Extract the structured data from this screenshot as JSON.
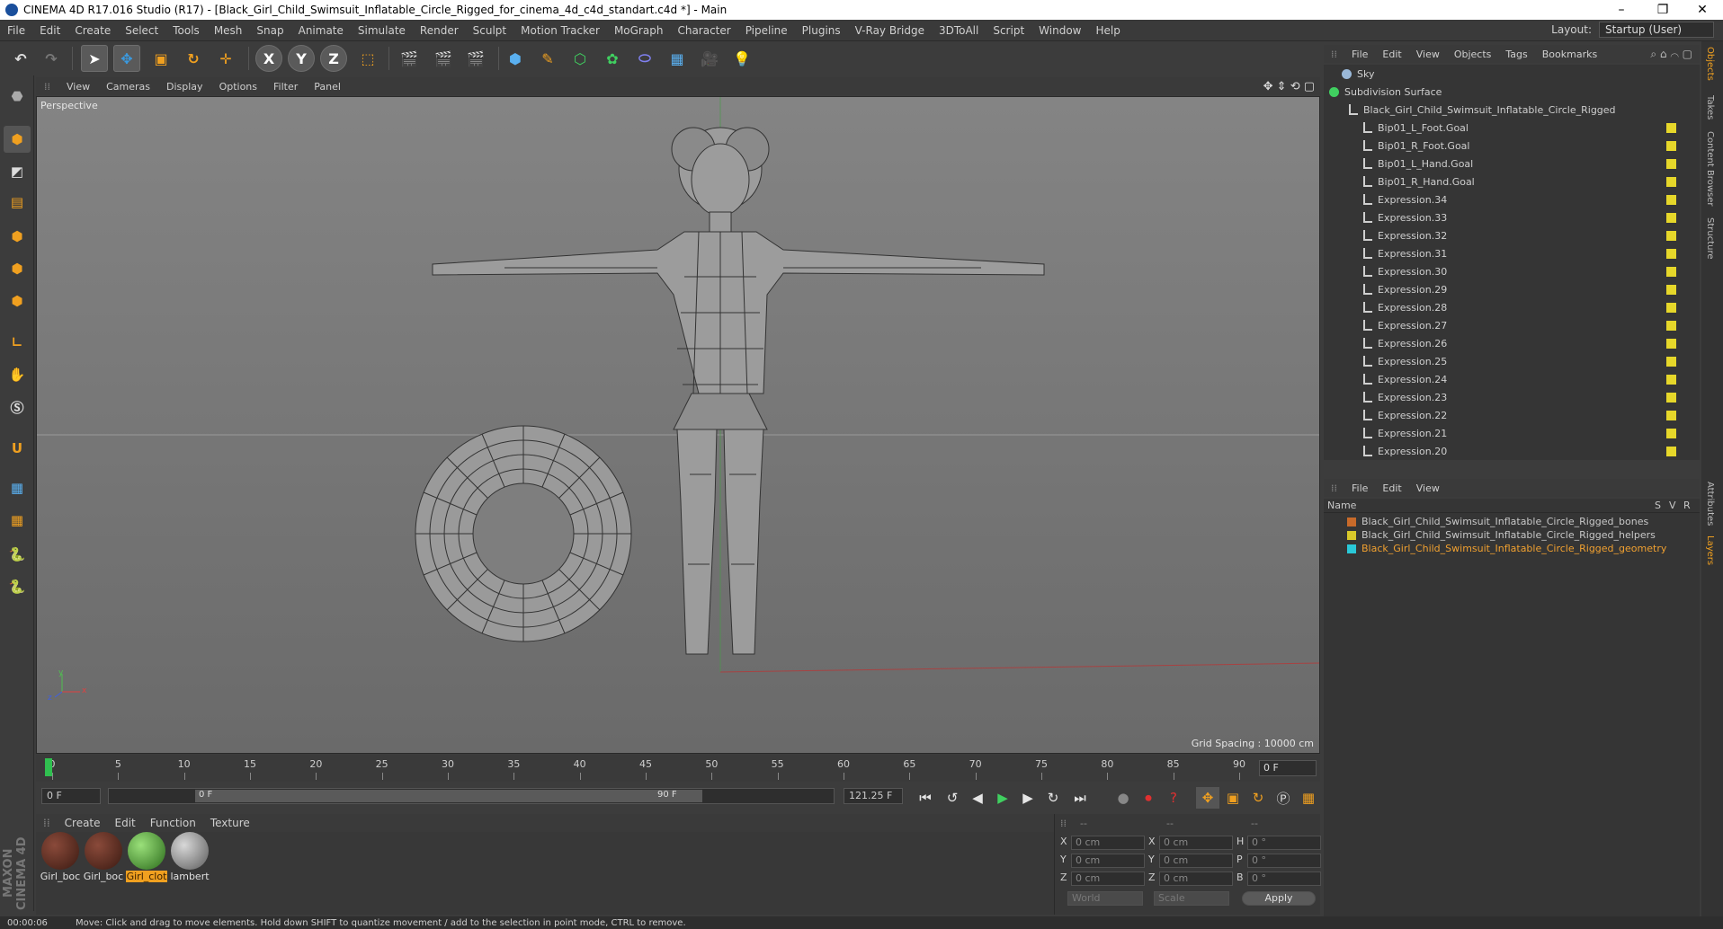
{
  "window": {
    "title": "CINEMA 4D R17.016 Studio (R17) - [Black_Girl_Child_Swimsuit_Inflatable_Circle_Rigged_for_cinema_4d_c4d_standart.c4d *] - Main"
  },
  "menubar": {
    "items": [
      "File",
      "Edit",
      "Create",
      "Select",
      "Tools",
      "Mesh",
      "Snap",
      "Animate",
      "Simulate",
      "Render",
      "Sculpt",
      "Motion Tracker",
      "MoGraph",
      "Character",
      "Pipeline",
      "Plugins",
      "V-Ray Bridge",
      "3DToAll",
      "Script",
      "Window",
      "Help"
    ],
    "layout_label": "Layout:",
    "layout_value": "Startup (User)"
  },
  "toolbar": {
    "axis_x": "X",
    "axis_y": "Y",
    "axis_z": "Z"
  },
  "viewport": {
    "menu": [
      "View",
      "Cameras",
      "Display",
      "Options",
      "Filter",
      "Panel"
    ],
    "camera_label": "Perspective",
    "grid_spacing": "Grid Spacing : 10000 cm",
    "axis_x": "x",
    "axis_y": "y",
    "axis_z": "z"
  },
  "timeline": {
    "ticks": [
      "0",
      "5",
      "10",
      "15",
      "20",
      "25",
      "30",
      "35",
      "40",
      "45",
      "50",
      "55",
      "60",
      "65",
      "70",
      "75",
      "80",
      "85",
      "90"
    ],
    "current_frame": "0 F",
    "start_frame": "0 F",
    "range_start": "0 F",
    "range_end": "90 F",
    "fps_field": "121.25 F"
  },
  "materials": {
    "menu": [
      "Create",
      "Edit",
      "Function",
      "Texture"
    ],
    "items": [
      {
        "name": "Girl_boc",
        "color": "#5a2a22"
      },
      {
        "name": "Girl_boc",
        "color": "#5a2a22"
      },
      {
        "name": "Girl_clot",
        "color": "#4a9a3a"
      },
      {
        "name": "lambert",
        "color": "#9a9a9a"
      }
    ]
  },
  "coords": {
    "header": [
      "--",
      "--",
      "--"
    ],
    "rows": [
      {
        "axis": "X",
        "pos": "0 cm",
        "axis2": "X",
        "size": "0 cm",
        "rot_axis": "H",
        "rot": "0 °"
      },
      {
        "axis": "Y",
        "pos": "0 cm",
        "axis2": "Y",
        "size": "0 cm",
        "rot_axis": "P",
        "rot": "0 °"
      },
      {
        "axis": "Z",
        "pos": "0 cm",
        "axis2": "Z",
        "size": "0 cm",
        "rot_axis": "B",
        "rot": "0 °"
      }
    ],
    "world": "World",
    "scale": "Scale",
    "apply": "Apply"
  },
  "objects": {
    "menu": [
      "File",
      "Edit",
      "View",
      "Objects",
      "Tags",
      "Bookmarks"
    ],
    "items": [
      "Sky",
      "Subdivision Surface",
      "Black_Girl_Child_Swimsuit_Inflatable_Circle_Rigged",
      "Bip01_L_Foot.Goal",
      "Bip01_R_Foot.Goal",
      "Bip01_L_Hand.Goal",
      "Bip01_R_Hand.Goal",
      "Expression.34",
      "Expression.33",
      "Expression.32",
      "Expression.31",
      "Expression.30",
      "Expression.29",
      "Expression.28",
      "Expression.27",
      "Expression.26",
      "Expression.25",
      "Expression.24",
      "Expression.23",
      "Expression.22",
      "Expression.21",
      "Expression.20"
    ]
  },
  "layers": {
    "menu": [
      "File",
      "Edit",
      "View"
    ],
    "header_name": "Name",
    "header_cols": [
      "S",
      "V",
      "R"
    ],
    "items": [
      {
        "name": "Black_Girl_Child_Swimsuit_Inflatable_Circle_Rigged_bones",
        "color": "#c86a2a",
        "text": "#cfcfcf"
      },
      {
        "name": "Black_Girl_Child_Swimsuit_Inflatable_Circle_Rigged_helpers",
        "color": "#d8c82a",
        "text": "#cfcfcf"
      },
      {
        "name": "Black_Girl_Child_Swimsuit_Inflatable_Circle_Rigged_geometry",
        "color": "#2ac8d8",
        "text": "#f0a030"
      }
    ]
  },
  "sidetabs": [
    "Objects",
    "Takes",
    "Content Browser",
    "Structure",
    "Attributes",
    "Layers"
  ],
  "status": {
    "time": "00:00:06",
    "message": "Move: Click and drag to move elements. Hold down SHIFT to quantize movement / add to the selection in point mode, CTRL to remove."
  },
  "brand": "MAXON CINEMA 4D"
}
